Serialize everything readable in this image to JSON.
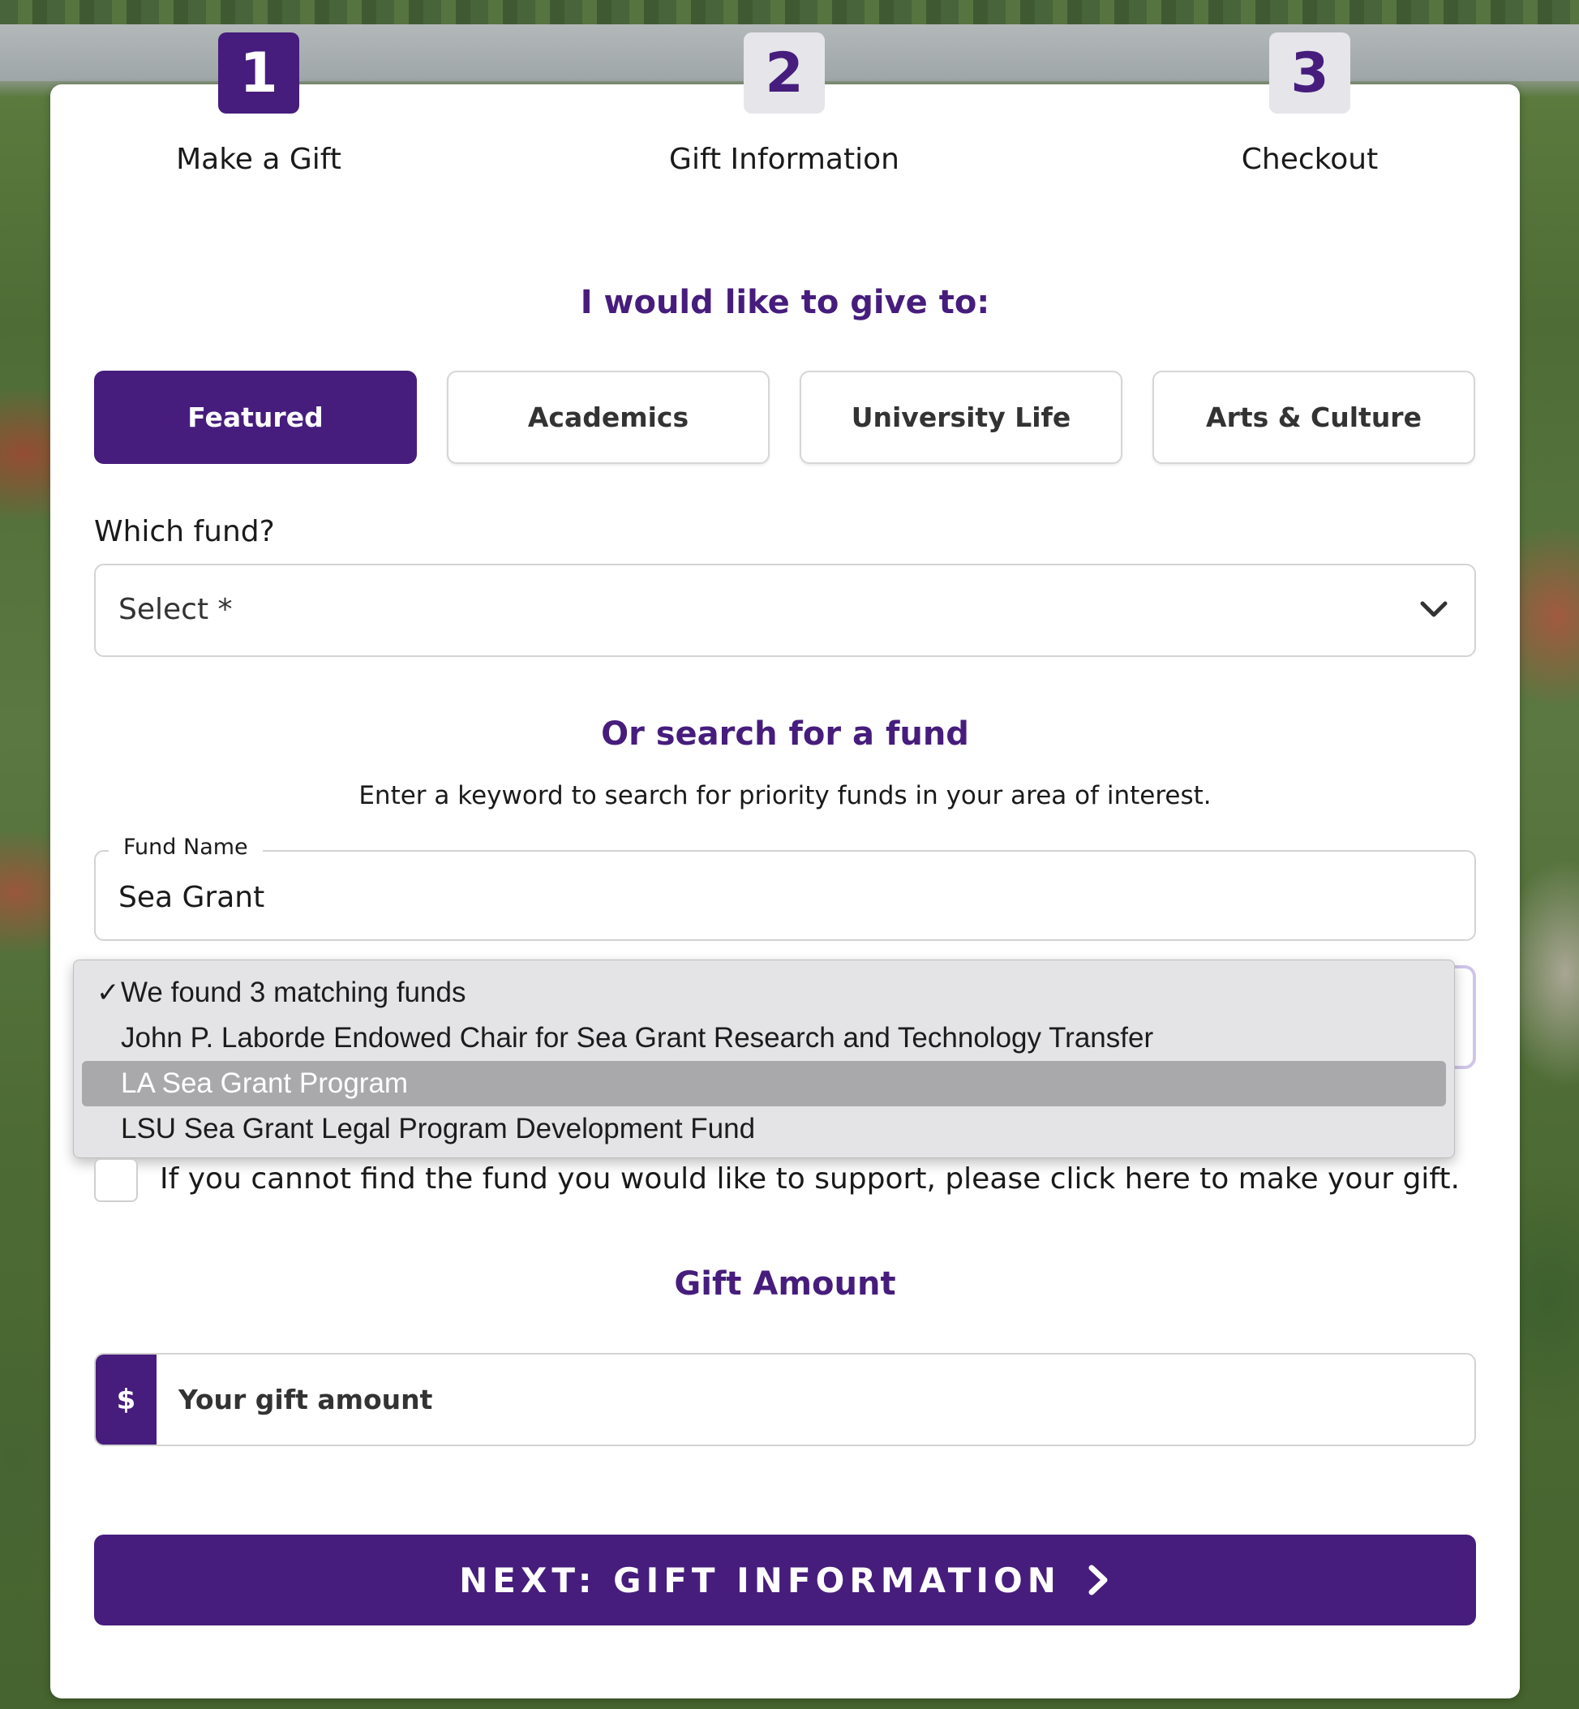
{
  "steps": [
    {
      "number": "1",
      "label": "Make a Gift",
      "state": "active"
    },
    {
      "number": "2",
      "label": "Gift Information",
      "state": "inactive"
    },
    {
      "number": "3",
      "label": "Checkout",
      "state": "inactive"
    }
  ],
  "give_heading": "I would like to give to:",
  "categories": [
    {
      "label": "Featured",
      "selected": true
    },
    {
      "label": "Academics",
      "selected": false
    },
    {
      "label": "University Life",
      "selected": false
    },
    {
      "label": "Arts & Culture",
      "selected": false
    }
  ],
  "which_fund": {
    "label": "Which fund?",
    "select_placeholder": "Select *",
    "icon": "chevron-down-icon"
  },
  "search": {
    "heading": "Or search for a fund",
    "description": "Enter a keyword to search for priority funds in your area of interest.",
    "field_label": "Fund Name",
    "field_value": "Sea Grant"
  },
  "results_dropdown": {
    "items": [
      {
        "label": "We found 3 matching funds",
        "checked": true,
        "highlighted": false
      },
      {
        "label": "John P. Laborde Endowed Chair for Sea Grant Research and Technology Transfer",
        "checked": false,
        "highlighted": false
      },
      {
        "label": "LA Sea Grant Program",
        "checked": false,
        "highlighted": true
      },
      {
        "label": "LSU Sea Grant Legal Program Development Fund",
        "checked": false,
        "highlighted": false
      }
    ]
  },
  "fallback_checkbox": {
    "label": "If you cannot find the fund you would like to support, please click here to make your gift.",
    "checked": false
  },
  "gift_amount": {
    "heading": "Gift Amount",
    "currency_symbol": "$",
    "placeholder": "Your gift amount"
  },
  "next_button": {
    "label": "NEXT: GIFT INFORMATION",
    "icon": "chevron-right-icon"
  },
  "colors": {
    "brand_purple": "#461d7c",
    "step_inactive_bg": "#e5e5ea",
    "dropdown_bg": "#e4e4e6",
    "dropdown_highlight": "#a9a9ab"
  }
}
